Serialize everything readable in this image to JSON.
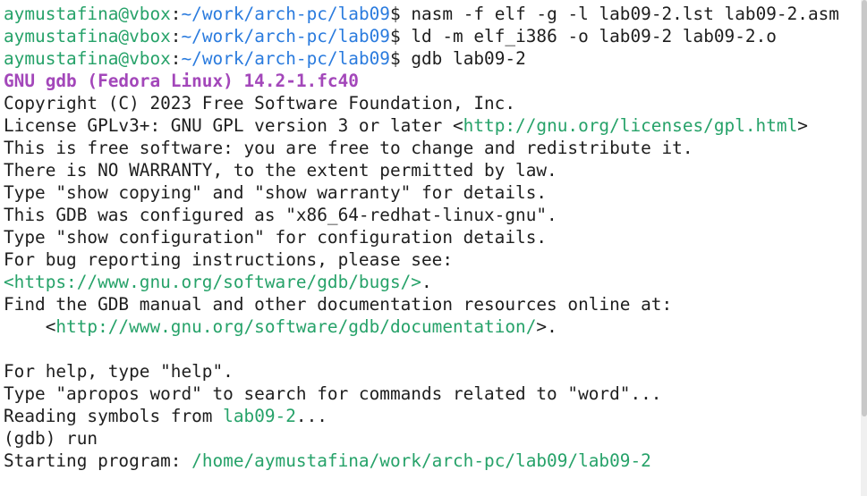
{
  "terminal": {
    "prompt": {
      "user_host": "aymustafina@vbox",
      "sep": ":",
      "path": "~/work/arch-pc/lab09",
      "sign": "$ "
    },
    "commands": [
      "nasm -f elf -g -l lab09-2.lst lab09-2.asm",
      "ld -m elf_i386 -o lab09-2 lab09-2.o",
      "gdb lab09-2"
    ],
    "gdb_header": "GNU gdb (Fedora Linux) 14.2-1.fc40",
    "copyright": "Copyright (C) 2023 Free Software Foundation, Inc.",
    "license_prefix": "License GPLv3+: GNU GPL version 3 or later <",
    "license_url": "http://gnu.org/licenses/gpl.html",
    "license_suffix": ">",
    "free_software": "This is free software: you are free to change and redistribute it.",
    "no_warranty": "There is NO WARRANTY, to the extent permitted by law.",
    "show_copying": "Type \"show copying\" and \"show warranty\" for details.",
    "configured": "This GDB was configured as \"x86_64-redhat-linux-gnu\".",
    "show_config": "Type \"show configuration\" for configuration details.",
    "bug_reporting": "For bug reporting instructions, please see:",
    "bugs_url": "<https://www.gnu.org/software/gdb/bugs/>",
    "bugs_suffix": ".",
    "find_manual": "Find the GDB manual and other documentation resources online at:",
    "doc_prefix": "    <",
    "doc_url": "http://www.gnu.org/software/gdb/documentation/",
    "doc_suffix": ">.",
    "help": "For help, type \"help\".",
    "apropos": "Type \"apropos word\" to search for commands related to \"word\"...",
    "reading_prefix": "Reading symbols from ",
    "reading_file": "lab09-2",
    "reading_suffix": "...",
    "gdb_run": "(gdb) run",
    "starting_prefix": "Starting program: ",
    "starting_path": "/home/aymustafina/work/arch-pc/lab09/lab09-2"
  }
}
